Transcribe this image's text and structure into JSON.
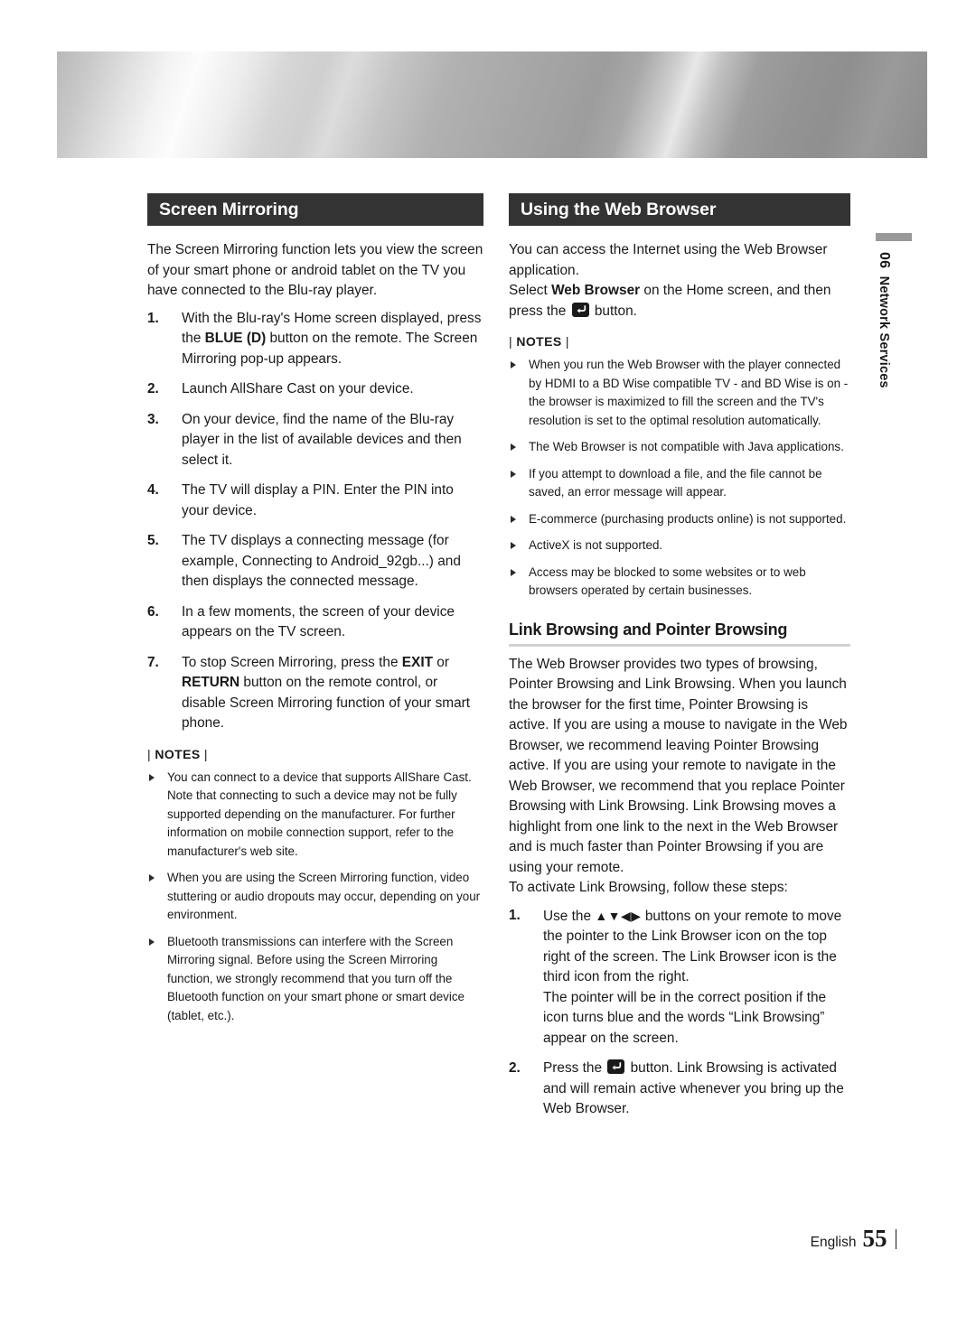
{
  "header": {
    "banner_alt": "brushed-metal-banner"
  },
  "side_tab": {
    "chapter_number": "06",
    "chapter_title": "Network Services"
  },
  "left_column": {
    "section_title": "Screen Mirroring",
    "intro": "The Screen Mirroring function lets you view the screen of your smart phone or android tablet on the TV you have connected to the Blu-ray player.",
    "steps": [
      {
        "num": "1.",
        "parts": [
          {
            "t": "With the Blu-ray's Home screen displayed, press the "
          },
          {
            "t": "BLUE (D)",
            "bold": true
          },
          {
            "t": " button on the remote. The Screen Mirroring pop-up appears."
          }
        ]
      },
      {
        "num": "2.",
        "parts": [
          {
            "t": "Launch AllShare Cast on your device."
          }
        ]
      },
      {
        "num": "3.",
        "parts": [
          {
            "t": "On your device, find the name of the Blu-ray player in the list of available devices and then select it."
          }
        ]
      },
      {
        "num": "4.",
        "parts": [
          {
            "t": "The TV will display a PIN. Enter the PIN into your device."
          }
        ]
      },
      {
        "num": "5.",
        "parts": [
          {
            "t": "The TV displays a connecting message (for example, Connecting to Android_92gb...) and then displays the connected message."
          }
        ]
      },
      {
        "num": "6.",
        "parts": [
          {
            "t": "In a few moments, the screen of your device appears on the TV screen."
          }
        ]
      },
      {
        "num": "7.",
        "parts": [
          {
            "t": "To stop Screen Mirroring, press the "
          },
          {
            "t": "EXIT",
            "bold": true
          },
          {
            "t": " or "
          },
          {
            "t": "RETURN",
            "bold": true
          },
          {
            "t": " button on the remote control, or disable Screen Mirroring function of your smart phone."
          }
        ]
      }
    ],
    "notes_label": "NOTES",
    "notes": [
      "You can connect to a device that supports AllShare Cast. Note that connecting to such a device may not be fully supported depending on the manufacturer. For further information on mobile connection support, refer to the manufacturer's web site.",
      "When you are using the Screen Mirroring function, video stuttering or audio dropouts may occur, depending on your environment.",
      "Bluetooth transmissions can interfere with the Screen Mirroring signal. Before using the Screen Mirroring function, we strongly recommend that you turn off the Bluetooth function on your smart phone or smart device (tablet, etc.)."
    ]
  },
  "right_column": {
    "section_title": "Using the Web Browser",
    "intro": "You can access the Internet using the Web Browser application.",
    "select_line": [
      {
        "t": "Select "
      },
      {
        "t": "Web Browser",
        "bold": true
      },
      {
        "t": " on the Home screen, and then press the "
      },
      {
        "t": "enter-button-icon",
        "icon": true
      },
      {
        "t": " button."
      }
    ],
    "notes_label": "NOTES",
    "notes": [
      "When you run the Web Browser with the player connected by HDMI to a BD Wise compatible TV - and BD Wise is on - the browser is maximized to fill the screen and the TV's resolution is set to the optimal resolution automatically.",
      "The Web Browser is not compatible with Java applications.",
      "If you attempt to download a file, and the file cannot be saved, an error message will appear.",
      "E-commerce (purchasing products online) is not supported.",
      "ActiveX is not supported.",
      "Access may be blocked to some websites or to web browsers operated by certain businesses."
    ],
    "subsection_title": "Link Browsing and Pointer Browsing",
    "subsection_body": "The Web Browser provides two types of browsing, Pointer Browsing and Link Browsing. When you launch the browser for the first time, Pointer Browsing is active. If you are using a mouse to navigate in the Web Browser, we recommend leaving Pointer Browsing active. If you are using your remote to navigate in the Web Browser, we recommend that you replace Pointer Browsing with Link Browsing. Link Browsing moves a highlight from one link to the next in the Web Browser and is much faster than Pointer Browsing if you are using your remote.",
    "subsection_lead": "To activate Link Browsing, follow these steps:",
    "steps": [
      {
        "num": "1.",
        "parts": [
          {
            "t": "Use the "
          },
          {
            "t": "arrow-buttons-icon",
            "arrows": "▲▼◀▶"
          },
          {
            "t": " buttons on your remote to move the pointer to the Link Browser icon on the top right of the screen. The Link Browser icon is the third icon from the right."
          },
          {
            "t": "\nThe pointer will be in the correct position if the icon turns blue and the words “Link Browsing” appear on the screen.",
            "newline": true
          }
        ]
      },
      {
        "num": "2.",
        "parts": [
          {
            "t": "Press the "
          },
          {
            "t": "enter-button-icon",
            "icon": true
          },
          {
            "t": " button. Link Browsing is activated and will remain active whenever you bring up the Web Browser."
          }
        ]
      }
    ]
  },
  "footer": {
    "language": "English",
    "page_number": "55"
  },
  "colors": {
    "section_bar_bg": "#333333",
    "section_bar_text": "#ffffff",
    "body_text": "#1a1a1a",
    "rule": "#d2d2d2",
    "side_tab_bar": "#999999"
  }
}
